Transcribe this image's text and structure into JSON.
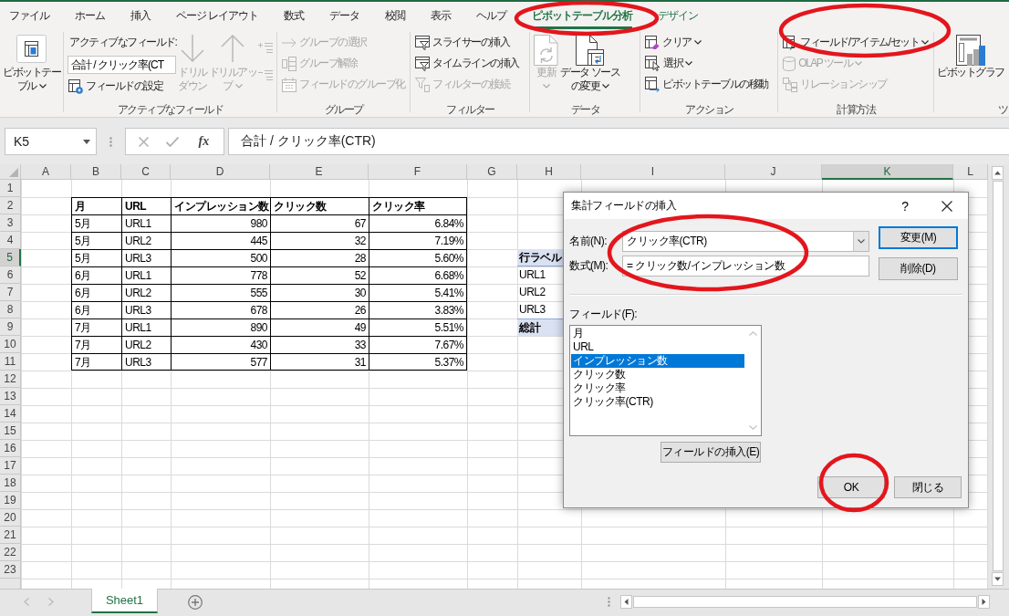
{
  "ribbon_tabs": [
    {
      "label": "ファイル",
      "selected": false,
      "contextual": false
    },
    {
      "label": "ホーム",
      "selected": false,
      "contextual": false
    },
    {
      "label": "挿入",
      "selected": false,
      "contextual": false
    },
    {
      "label": "ページ レイアウト",
      "selected": false,
      "contextual": false
    },
    {
      "label": "数式",
      "selected": false,
      "contextual": false
    },
    {
      "label": "データ",
      "selected": false,
      "contextual": false
    },
    {
      "label": "校閲",
      "selected": false,
      "contextual": false
    },
    {
      "label": "表示",
      "selected": false,
      "contextual": false
    },
    {
      "label": "ヘルプ",
      "selected": false,
      "contextual": false
    },
    {
      "label": "ピボットテーブル分析",
      "selected": true,
      "contextual": true
    },
    {
      "label": "デザイン",
      "selected": false,
      "contextual": true
    }
  ],
  "ribbon_groups": [
    {
      "columns": [
        [
          {
            "kind": "large",
            "lines": [
              "ピボットテー",
              "ブル"
            ],
            "dropdown": true,
            "disabled": false
          }
        ]
      ]
    },
    {
      "label": "アクティブなフィールド",
      "columns": [
        [
          {
            "kind": "caption",
            "text": "アクティブなフィールド:"
          },
          {
            "kind": "field",
            "value": "合計 / クリック率(CT"
          },
          {
            "kind": "small",
            "label": "フィールドの設定",
            "dropdown": false,
            "disabled": false
          }
        ],
        [
          {
            "kind": "large",
            "lines": [
              "ドリル",
              "ダウン"
            ],
            "dropdown": false,
            "disabled": true
          }
        ],
        [
          {
            "kind": "large",
            "lines": [
              "ドリルアッ",
              "プ"
            ],
            "dropdown": true,
            "disabled": true
          }
        ],
        [
          {
            "kind": "mini",
            "disabled": true
          },
          {
            "kind": "mini",
            "disabled": true
          }
        ]
      ]
    },
    {
      "label": "グループ",
      "columns": [
        [
          {
            "kind": "small",
            "label": "グループの選択",
            "dropdown": false,
            "disabled": true
          },
          {
            "kind": "small",
            "label": "グループ解除",
            "dropdown": false,
            "disabled": true
          },
          {
            "kind": "small",
            "label": "フィールドのグループ化",
            "dropdown": false,
            "disabled": true
          }
        ]
      ]
    },
    {
      "label": "フィルター",
      "columns": [
        [
          {
            "kind": "small",
            "label": "スライサーの挿入",
            "dropdown": false,
            "disabled": false
          },
          {
            "kind": "small",
            "label": "タイムラインの挿入",
            "dropdown": false,
            "disabled": false
          },
          {
            "kind": "small",
            "label": "フィルターの接続",
            "dropdown": false,
            "disabled": true
          }
        ]
      ]
    },
    {
      "label": "データ",
      "columns": [
        [
          {
            "kind": "large",
            "lines": [
              "更新"
            ],
            "dropdown": true,
            "disabled": true
          }
        ],
        [
          {
            "kind": "large",
            "lines": [
              "データ ソース",
              "の変更"
            ],
            "dropdown": true,
            "disabled": false
          }
        ]
      ]
    },
    {
      "label": "アクション",
      "columns": [
        [
          {
            "kind": "small",
            "label": "クリア",
            "dropdown": true,
            "disabled": false
          },
          {
            "kind": "small",
            "label": "選択",
            "dropdown": true,
            "disabled": false
          },
          {
            "kind": "small",
            "label": "ピボットテーブルの移動",
            "dropdown": false,
            "disabled": false
          }
        ]
      ]
    },
    {
      "label": "計算方法",
      "columns": [
        [
          {
            "kind": "small",
            "label": "フィールド/アイテム/セット",
            "dropdown": true,
            "disabled": false
          },
          {
            "kind": "small",
            "label": "OLAP ツール",
            "dropdown": true,
            "disabled": true
          },
          {
            "kind": "small",
            "label": "リレーションシップ",
            "dropdown": false,
            "disabled": true
          }
        ]
      ]
    },
    {
      "label": "ツ",
      "columns": [
        [
          {
            "kind": "large",
            "lines": [
              "ピボットグラフ"
            ],
            "dropdown": false,
            "disabled": false
          }
        ]
      ]
    }
  ],
  "formula_bar": {
    "name_box": "K5",
    "function_label": "fx",
    "formula": "合計 / クリック率(CTR)"
  },
  "sheet": {
    "columns": [
      {
        "label": "A",
        "selected": false
      },
      {
        "label": "B",
        "selected": false
      },
      {
        "label": "C",
        "selected": false
      },
      {
        "label": "D",
        "selected": false
      },
      {
        "label": "E",
        "selected": false
      },
      {
        "label": "F",
        "selected": false
      },
      {
        "label": "G",
        "selected": false
      },
      {
        "label": "H",
        "selected": false
      },
      {
        "label": "I",
        "selected": false
      },
      {
        "label": "J",
        "selected": false
      },
      {
        "label": "K",
        "selected": true
      },
      {
        "label": "L",
        "selected": false
      }
    ],
    "rows": [
      {
        "label": "1",
        "selected": false
      },
      {
        "label": "2",
        "selected": false
      },
      {
        "label": "3",
        "selected": false
      },
      {
        "label": "4",
        "selected": false
      },
      {
        "label": "5",
        "selected": true
      },
      {
        "label": "6",
        "selected": false
      },
      {
        "label": "7",
        "selected": false
      },
      {
        "label": "8",
        "selected": false
      },
      {
        "label": "9",
        "selected": false
      },
      {
        "label": "10",
        "selected": false
      },
      {
        "label": "11",
        "selected": false
      },
      {
        "label": "12",
        "selected": false
      },
      {
        "label": "13",
        "selected": false
      },
      {
        "label": "14",
        "selected": false
      },
      {
        "label": "15",
        "selected": false
      },
      {
        "label": "16",
        "selected": false
      },
      {
        "label": "17",
        "selected": false
      },
      {
        "label": "18",
        "selected": false
      },
      {
        "label": "19",
        "selected": false
      },
      {
        "label": "20",
        "selected": false
      },
      {
        "label": "21",
        "selected": false
      },
      {
        "label": "22",
        "selected": false
      },
      {
        "label": "23",
        "selected": false
      }
    ],
    "data_table": {
      "header": [
        "月",
        "URL",
        "インプレッション数",
        "クリック数",
        "クリック率"
      ],
      "rows": [
        [
          "5月",
          "URL1",
          "980",
          "67",
          "6.84%"
        ],
        [
          "5月",
          "URL2",
          "445",
          "32",
          "7.19%"
        ],
        [
          "5月",
          "URL3",
          "500",
          "28",
          "5.60%"
        ],
        [
          "6月",
          "URL1",
          "778",
          "52",
          "6.68%"
        ],
        [
          "6月",
          "URL2",
          "555",
          "30",
          "5.41%"
        ],
        [
          "6月",
          "URL3",
          "678",
          "26",
          "3.83%"
        ],
        [
          "7月",
          "URL1",
          "890",
          "49",
          "5.51%"
        ],
        [
          "7月",
          "URL2",
          "430",
          "33",
          "7.67%"
        ],
        [
          "7月",
          "URL3",
          "577",
          "31",
          "5.37%"
        ]
      ]
    },
    "pivot_table": {
      "header": "行ラベル",
      "rows": [
        "URL1",
        "URL2",
        "URL3"
      ],
      "total": "総計"
    }
  },
  "sheet_tabs": [
    {
      "label": "Sheet1",
      "selected": true
    }
  ],
  "dialog": {
    "title": "集計フィールドの挿入",
    "help": "?",
    "name_label": "名前(N):",
    "name_value": "クリック率(CTR)",
    "formula_label": "数式(M):",
    "formula_value": "= クリック数/インプレッション数",
    "side_buttons": [
      {
        "label": "変更(M)",
        "default": true
      },
      {
        "label": "削除(D)",
        "default": false
      }
    ],
    "fields_label": "フィールド(F):",
    "fields": [
      {
        "label": "月",
        "selected": false
      },
      {
        "label": "URL",
        "selected": false
      },
      {
        "label": "インプレッション数",
        "selected": true
      },
      {
        "label": "クリック数",
        "selected": false
      },
      {
        "label": "クリック率",
        "selected": false
      },
      {
        "label": "クリック率(CTR)",
        "selected": false
      }
    ],
    "insert_field_button": "フィールドの挿入(E)",
    "buttons": [
      "OK",
      "閉じる"
    ]
  },
  "annotations": [
    {
      "kind": "ellipse"
    },
    {
      "kind": "ellipse"
    },
    {
      "kind": "ellipse"
    },
    {
      "kind": "ellipse"
    }
  ]
}
